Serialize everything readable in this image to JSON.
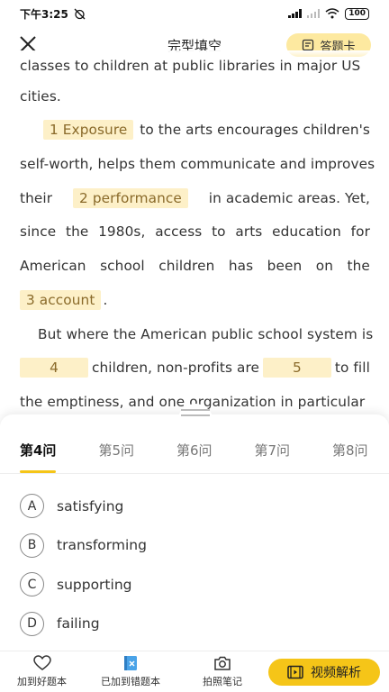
{
  "status_bar": {
    "time": "下午3:25",
    "battery": "100"
  },
  "nav": {
    "title": "完型填空",
    "answer_card_label": "答题卡"
  },
  "passage": {
    "l0_text": "classes to children at public libraries in major US",
    "l1_text": "cities.",
    "blank1": "1 Exposure",
    "l2_rest": "to the arts encourages children's",
    "l3_text": "self-worth, helps them communicate and improves",
    "l4_a": "their",
    "blank2": "2 performance",
    "l4_b": "in academic areas. Yet,",
    "l5_w": [
      "since",
      "the",
      "1980s,",
      "access",
      "to",
      "arts",
      "education",
      "for"
    ],
    "l6_w": [
      "American",
      "school",
      "children",
      "has",
      "been",
      "on",
      "the"
    ],
    "blank3": "3 account",
    "l7_punct": ".",
    "l8_text": "But where the American public school system is",
    "blank4": "4",
    "l9_mid": "children, non-profits are",
    "blank5": "5",
    "l9_end": "to fill",
    "l10_text": "the emptiness, and one organization in particular"
  },
  "tabs": [
    "第4问",
    "第5问",
    "第6问",
    "第7问",
    "第8问"
  ],
  "options": [
    {
      "letter": "A",
      "text": "satisfying"
    },
    {
      "letter": "B",
      "text": "transforming"
    },
    {
      "letter": "C",
      "text": "supporting"
    },
    {
      "letter": "D",
      "text": "failing"
    }
  ],
  "toolbar": {
    "favorite_label": "加到好题本",
    "wrong_label": "已加到错题本",
    "photo_label": "拍照笔记",
    "video_label": "视频解析"
  },
  "colors": {
    "accent": "#f5c518",
    "blank_bg": "#fdf0c8",
    "chip_bg": "#fde9a0"
  },
  "icons": [
    "close-icon",
    "answer-card-icon",
    "heart-icon",
    "wrong-book-icon",
    "camera-icon",
    "video-icon"
  ]
}
